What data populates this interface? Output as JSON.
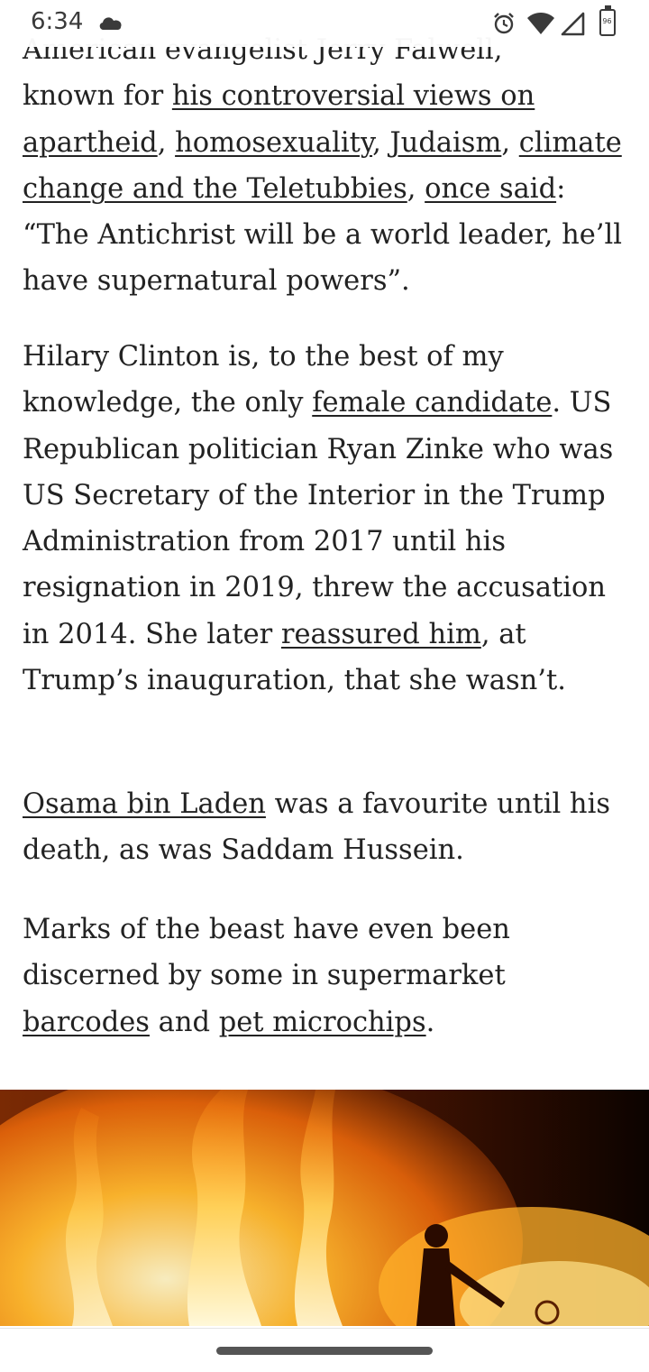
{
  "status_bar": {
    "time": "6:34",
    "battery_label": "96"
  },
  "article": {
    "paragraph1": {
      "clipped_line": "American evangelist Jerry Falwell,",
      "t1": "known for ",
      "link1": "his controversial views on apartheid",
      "t2": ", ",
      "link2": "homosexuality",
      "t3": ", ",
      "link3": "Judaism",
      "t4": ", ",
      "link4": "climate change and the Teletubbies",
      "t5": ", ",
      "link5": "once said",
      "t6": ": “The Antichrist will be a world leader, he’ll have supernatural powers”."
    },
    "paragraph2": {
      "t1": "Hilary Clinton is, to the best of my knowledge, the only ",
      "link1": "female candidate",
      "t2": ". US Republican politician Ryan Zinke who was US Secretary of the Interior in the Trump Administration from 2017 until his resignation in 2019, threw the accusation in 2014. She later ",
      "link2": "reassured him",
      "t3": ", at Trump’s inauguration, that she wasn’t."
    },
    "paragraph3": {
      "link1": "Osama bin Laden",
      "t1": " was a favourite until his death, as was Saddam Hussein."
    },
    "paragraph4": {
      "t1": "Marks of the beast have even been discerned by some in supermarket ",
      "link1": "barcodes",
      "t2": " and ",
      "link2": "pet microchips",
      "t3": "."
    }
  },
  "colors": {
    "text": "#222222",
    "background": "#ffffff",
    "nav_handle": "#555555"
  }
}
